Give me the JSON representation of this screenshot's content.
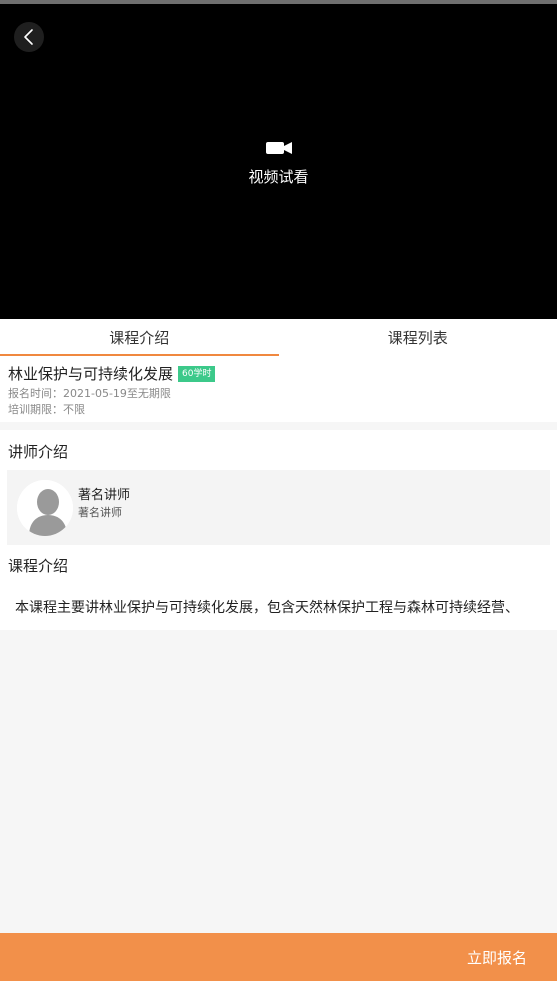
{
  "video": {
    "label": "视频试看"
  },
  "tabs": [
    {
      "label": "课程介绍",
      "active": true
    },
    {
      "label": "课程列表",
      "active": false
    }
  ],
  "course": {
    "title": "林业保护与可持续化发展",
    "hours_badge": "60学时",
    "enroll_time": "报名时间：2021-05-19至无期限",
    "training_period": "培训期限：不限"
  },
  "teacher_section": {
    "title": "讲师介绍",
    "name": "著名讲师",
    "subtitle": "著名讲师"
  },
  "intro_section": {
    "title": "课程介绍",
    "text": "本课程主要讲林业保护与可持续化发展，包含天然林保护工程与森林可持续经营、"
  },
  "bottom": {
    "enroll_label": "立即报名"
  },
  "colors": {
    "accent": "#f0883f",
    "badge": "#3cc98a",
    "bottom_bar": "#f2904a"
  }
}
